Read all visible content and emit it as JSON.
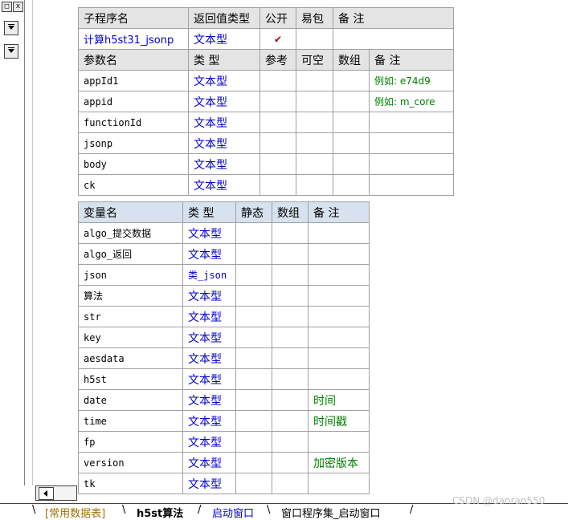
{
  "left_panel": {
    "restore_glyph": "□",
    "close_glyph": "x"
  },
  "sub_table": {
    "headers": [
      "子程序名",
      "返回值类型",
      "公开",
      "易包",
      "备 注"
    ],
    "name": "计算h5st31_jsonp",
    "return_type": "文本型",
    "public_mark": "✔",
    "param_headers": [
      "参数名",
      "类 型",
      "参考",
      "可空",
      "数组",
      "备 注"
    ],
    "params": [
      {
        "name": "appId1",
        "type": "文本型",
        "note": "例如: e74d9"
      },
      {
        "name": "appid",
        "type": "文本型",
        "note": "例如: m_core"
      },
      {
        "name": "functionId",
        "type": "文本型",
        "note": ""
      },
      {
        "name": "jsonp",
        "type": "文本型",
        "note": ""
      },
      {
        "name": "body",
        "type": "文本型",
        "note": ""
      },
      {
        "name": "ck",
        "type": "文本型",
        "note": ""
      }
    ]
  },
  "var_table": {
    "headers": [
      "变量名",
      "类 型",
      "静态",
      "数组",
      "备 注"
    ],
    "rows": [
      {
        "name": "algo_提交数据",
        "type": "文本型",
        "note": ""
      },
      {
        "name": "algo_返回",
        "type": "文本型",
        "note": ""
      },
      {
        "name": "json",
        "type": "类_json",
        "note": ""
      },
      {
        "name": "算法",
        "type": "文本型",
        "note": ""
      },
      {
        "name": "str",
        "type": "文本型",
        "note": ""
      },
      {
        "name": "key",
        "type": "文本型",
        "note": ""
      },
      {
        "name": "aesdata",
        "type": "文本型",
        "note": ""
      },
      {
        "name": "h5st",
        "type": "文本型",
        "note": ""
      },
      {
        "name": "date",
        "type": "文本型",
        "note": "时间"
      },
      {
        "name": "time",
        "type": "文本型",
        "note": "时间戳"
      },
      {
        "name": "fp",
        "type": "文本型",
        "note": ""
      },
      {
        "name": "version",
        "type": "文本型",
        "note": "加密版本"
      },
      {
        "name": "tk",
        "type": "文本型",
        "note": ""
      }
    ]
  },
  "bottom_tabs": [
    {
      "label": "[常用数据表]",
      "state": "brown"
    },
    {
      "label": "h5st算法",
      "state": "active"
    },
    {
      "label": "启动窗口",
      "state": "inactive"
    },
    {
      "label": "窗口程序集_启动窗口",
      "state": "normal"
    }
  ],
  "watermark": "CSDN @danran550"
}
